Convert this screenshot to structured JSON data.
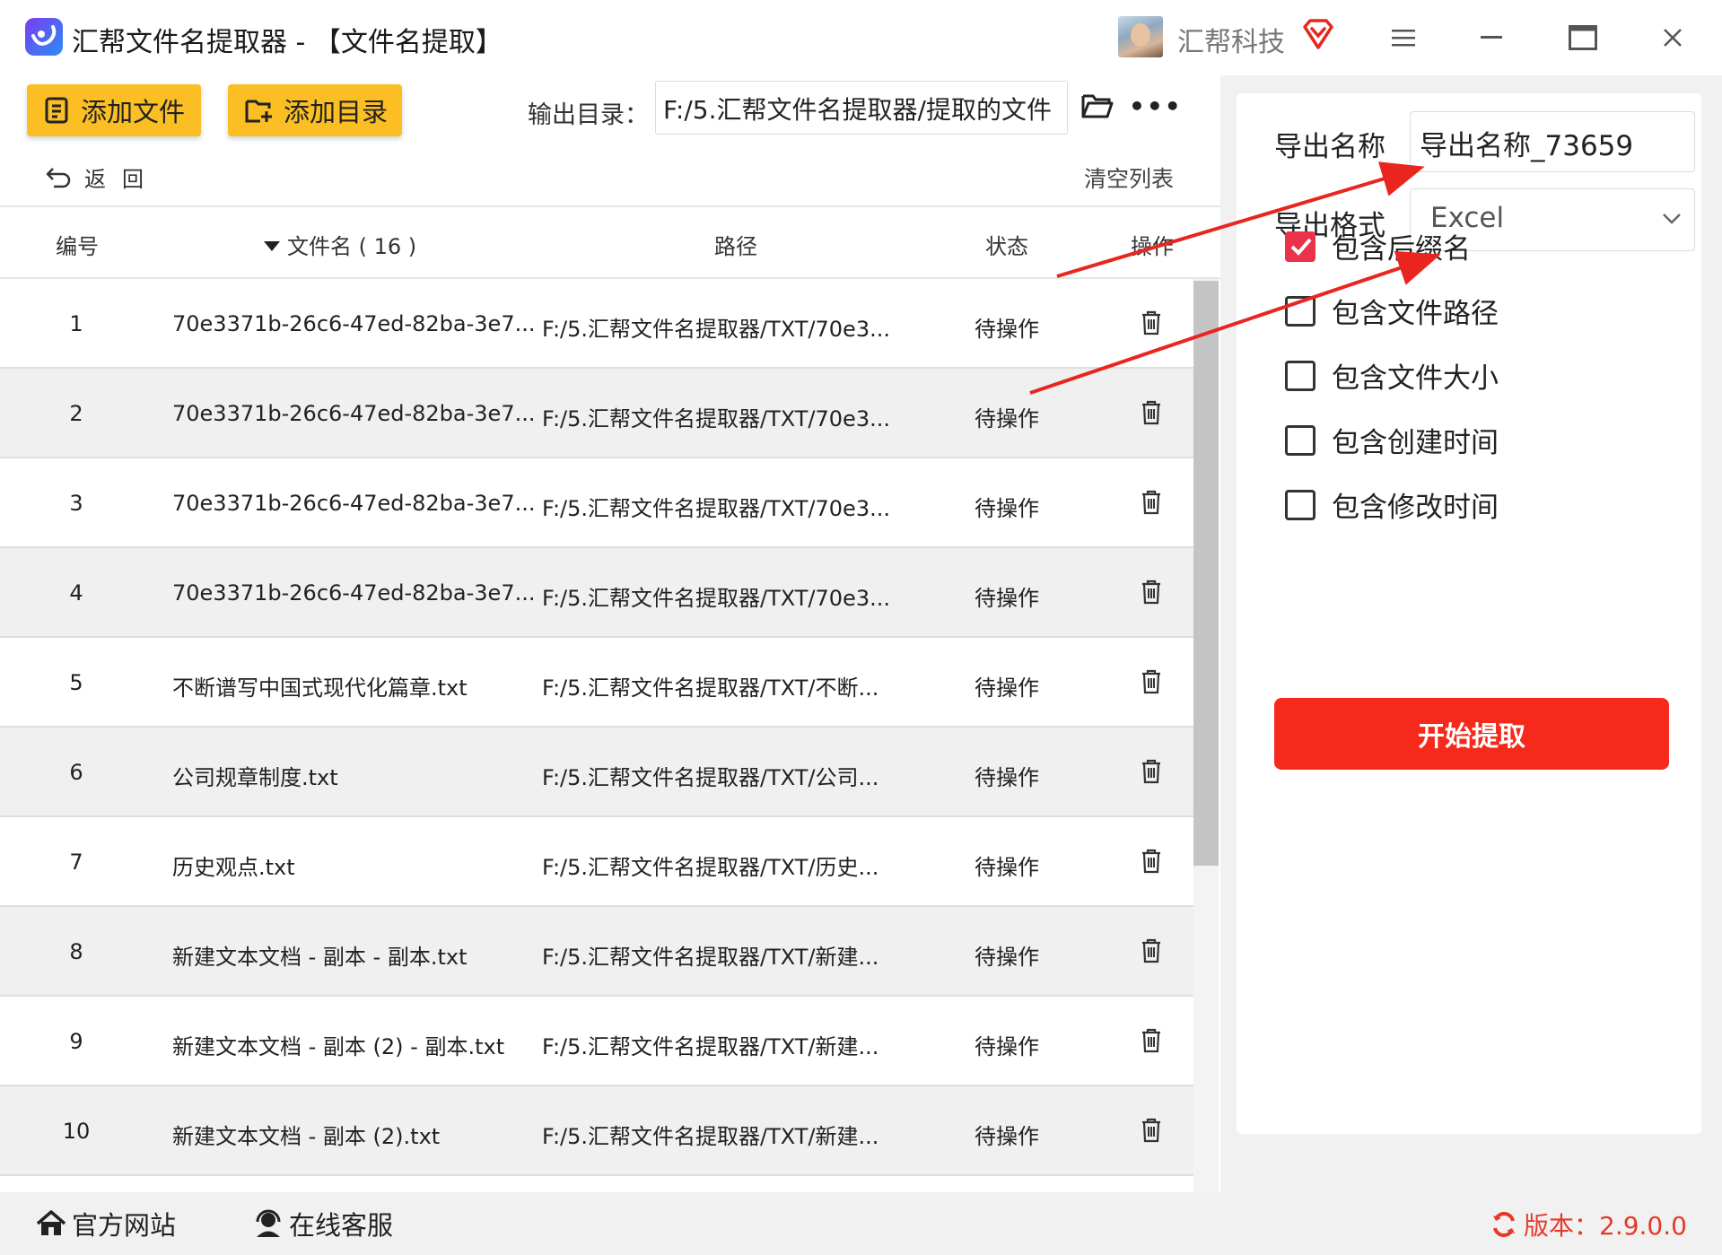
{
  "window": {
    "title": "汇帮文件名提取器 - 【文件名提取】",
    "company": "汇帮科技"
  },
  "toolbar": {
    "add_file_label": "添加文件",
    "add_dir_label": "添加目录",
    "output_label": "输出目录：",
    "output_path": "F:/5.汇帮文件名提取器/提取的文件",
    "back_label": "返回",
    "clear_label": "清空列表"
  },
  "table": {
    "headers": {
      "num": "编号",
      "name": "文件名 ( 16 )",
      "path": "路径",
      "status": "状态",
      "action": "操作"
    },
    "rows": [
      {
        "num": "1",
        "name": "70e3371b-26c6-47ed-82ba-3e7...",
        "path": "F:/5.汇帮文件名提取器/TXT/70e3...",
        "status": "待操作"
      },
      {
        "num": "2",
        "name": "70e3371b-26c6-47ed-82ba-3e7...",
        "path": "F:/5.汇帮文件名提取器/TXT/70e3...",
        "status": "待操作"
      },
      {
        "num": "3",
        "name": "70e3371b-26c6-47ed-82ba-3e7...",
        "path": "F:/5.汇帮文件名提取器/TXT/70e3...",
        "status": "待操作"
      },
      {
        "num": "4",
        "name": "70e3371b-26c6-47ed-82ba-3e7...",
        "path": "F:/5.汇帮文件名提取器/TXT/70e3...",
        "status": "待操作"
      },
      {
        "num": "5",
        "name": "不断谱写中国式现代化篇章.txt",
        "path": "F:/5.汇帮文件名提取器/TXT/不断...",
        "status": "待操作"
      },
      {
        "num": "6",
        "name": "公司规章制度.txt",
        "path": "F:/5.汇帮文件名提取器/TXT/公司...",
        "status": "待操作"
      },
      {
        "num": "7",
        "name": "历史观点.txt",
        "path": "F:/5.汇帮文件名提取器/TXT/历史...",
        "status": "待操作"
      },
      {
        "num": "8",
        "name": "新建文本文档 - 副本 - 副本.txt",
        "path": "F:/5.汇帮文件名提取器/TXT/新建...",
        "status": "待操作"
      },
      {
        "num": "9",
        "name": "新建文本文档 - 副本 (2) - 副本.txt",
        "path": "F:/5.汇帮文件名提取器/TXT/新建...",
        "status": "待操作"
      },
      {
        "num": "10",
        "name": "新建文本文档 - 副本 (2).txt",
        "path": "F:/5.汇帮文件名提取器/TXT/新建...",
        "status": "待操作"
      }
    ]
  },
  "settings": {
    "export_name_label": "导出名称",
    "export_name_value": "导出名称_73659",
    "export_format_label": "导出格式",
    "export_format_value": "Excel",
    "options": [
      {
        "label": "包含后缀名",
        "checked": true
      },
      {
        "label": "包含文件路径",
        "checked": false
      },
      {
        "label": "包含文件大小",
        "checked": false
      },
      {
        "label": "包含创建时间",
        "checked": false
      },
      {
        "label": "包含修改时间",
        "checked": false
      }
    ],
    "start_label": "开始提取"
  },
  "footer": {
    "website_label": "官方网站",
    "support_label": "在线客服",
    "version_label": "版本：2.9.0.0"
  },
  "colors": {
    "accent_yellow": "#fbbf24",
    "start_red": "#f52a1a",
    "checkbox_red": "#e8334a",
    "annotation_red": "#e8261f"
  },
  "table_state": {
    "scroll_fraction_visible": 0.64
  }
}
